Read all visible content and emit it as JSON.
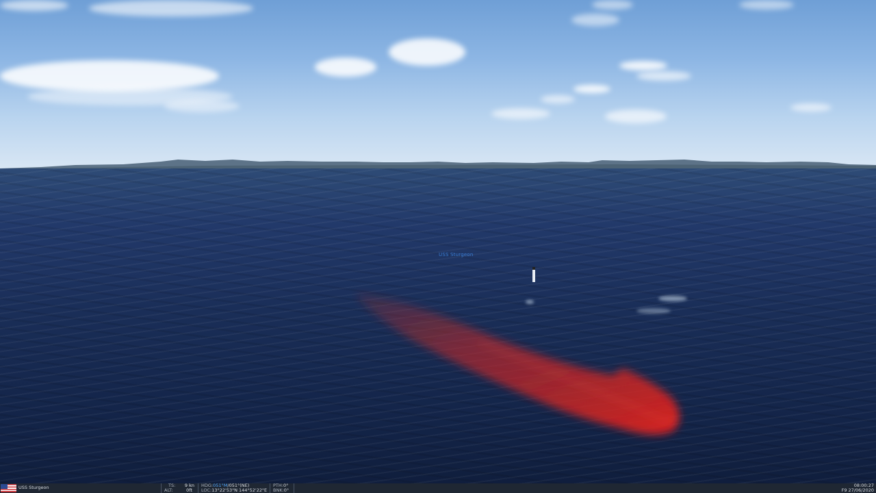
{
  "unit_label": "USS Sturgeon",
  "status": {
    "unit_name": "USS Sturgeon",
    "ts_label": "TS:",
    "ts_value": "9 kn",
    "alt_label": "ALT:",
    "alt_value": "0ft",
    "hdg_label": "HDG:",
    "hdg_magnetic": "051°M",
    "hdg_true": "/051°(NE)",
    "loc_label": "LOC:",
    "loc_value": "13°22'53\"N 144°52'22\"E",
    "pth_label": "PTH:",
    "pth_value": "0°",
    "bnk_label": "BNK:",
    "bnk_value": "0°",
    "time": "08:00:27",
    "date": "F9 27/06/2020"
  },
  "colors": {
    "submarine_highlight": "#e02020",
    "heading_accent": "#4fa5ff",
    "statusbar_bg": "#1f2733"
  },
  "icons": {
    "flag": "us-flag-icon"
  }
}
